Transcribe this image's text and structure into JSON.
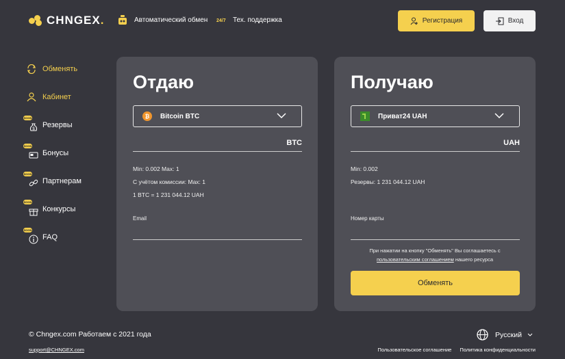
{
  "header": {
    "logo_text": "CHNGEX",
    "logo_dot": ".",
    "auto_exchange": "Автоматический обмен",
    "badge": "24/7",
    "support": "Тех. поддержка",
    "register_label": "Регистрация",
    "login_label": "Вход"
  },
  "sidebar": {
    "items": [
      {
        "label": "Обменять",
        "icon": "refresh-icon",
        "active": true
      },
      {
        "label": "Кабинет",
        "icon": "user-icon",
        "active": true
      },
      {
        "label": "Резервы",
        "icon": "moneybag-icon",
        "soon": "SOON"
      },
      {
        "label": "Бонусы",
        "icon": "card-icon",
        "soon": "SOON"
      },
      {
        "label": "Партнерам",
        "icon": "link-icon",
        "soon": "SOON"
      },
      {
        "label": "Конкурсы",
        "icon": "gift-icon",
        "soon": "SOON"
      },
      {
        "label": "FAQ",
        "icon": "info-icon",
        "soon": "SOON"
      }
    ]
  },
  "give": {
    "title": "Отдаю",
    "currency_select": "Bitcoin BTC",
    "currency_code": "BTC",
    "limits": "Min: 0.002 Max: 1",
    "commission": "С учётом комиссии: Max: 1",
    "rate": "1 BTC = 1 231 044.12 UAH",
    "field_label": "Email"
  },
  "get": {
    "title": "Получаю",
    "currency_select": "Приват24 UAH",
    "currency_code": "UAH",
    "limits": "Min: 0.002",
    "reserves": "Резервы: 1 231 044.12 UAH",
    "field_label": "Номер карты",
    "agree_text": "При нажатии на кнопку \"Обменять\" Вы соглашаетесь с",
    "agree_link": "пользовательским соглашением",
    "agree_suffix": " нашего ресурса",
    "exchange_button": "Обменять"
  },
  "footer": {
    "copyright": "© Chngex.com Работаем с 2021 года",
    "email": "support@CHNGEX.com",
    "language": "Русский",
    "links": [
      "Пользовательское соглашение",
      "Политика конфиденциальности"
    ]
  },
  "colors": {
    "background": "#36363d",
    "card": "#4f4f56",
    "accent": "#f5d04e"
  }
}
